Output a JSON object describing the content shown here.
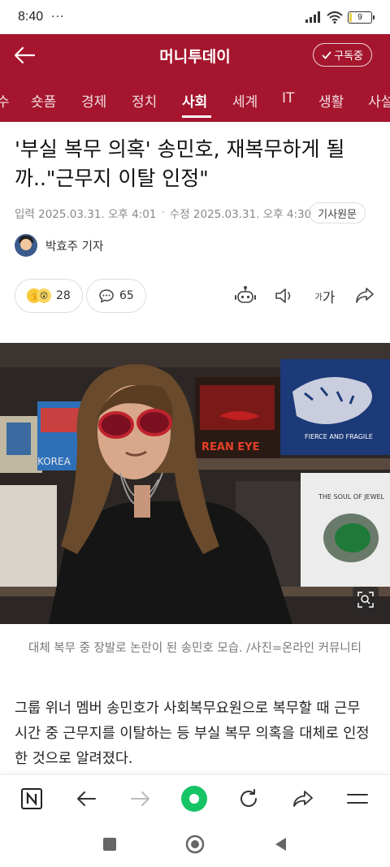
{
  "status_bar": {
    "time": "8:40",
    "notifications": "···",
    "battery": "9",
    "battery_level": 0.09
  },
  "app_bar": {
    "title": "머니투데이",
    "subscribe_label": "구독중"
  },
  "tabs": [
    {
      "label": "수"
    },
    {
      "label": "숏폼"
    },
    {
      "label": "경제"
    },
    {
      "label": "정치"
    },
    {
      "label": "사회",
      "active": true
    },
    {
      "label": "세계"
    },
    {
      "label": "IT"
    },
    {
      "label": "생활"
    },
    {
      "label": "사설"
    }
  ],
  "article": {
    "headline": "'부실 복무 의혹' 송민호, 재복무하게 될까..\"근무지 이탈 인정\"",
    "published": "입력 2025.03.31. 오후 4:01",
    "modified": "수정 2025.03.31. 오후 4:30",
    "origin_label": "기사원문",
    "reporter": "박효주 기자",
    "reactions_count": "28",
    "comments_count": "65",
    "font_label_small": "가",
    "font_label_large": "가",
    "photo_caption": "대체 복무 중 장발로 논란이 된 송민호 모습. /사진=온라인 커뮤니티",
    "photo_sign_1": "REAN EYE",
    "photo_sign_2": "FIERCE AND FRAGILE",
    "photo_sign_3": "THE SOUL OF JEWEL",
    "photo_sign_4": "KOREA",
    "body": "그룹 위너 멤버 송민호가 사회복무요원으로 복무할 때 근무 시간 중 근무지를 이탈하는 등 부실 복무 의혹을 대체로 인정한 것으로 알려졌다."
  },
  "colors": {
    "brand": "#a5162e",
    "accent_green": "#16c464"
  },
  "icons": {
    "back": "arrow-left-icon",
    "check": "check-icon",
    "ai": "robot-icon",
    "speaker": "speaker-icon",
    "share": "share-icon",
    "comment": "comment-icon",
    "zoom": "zoom-icon"
  }
}
